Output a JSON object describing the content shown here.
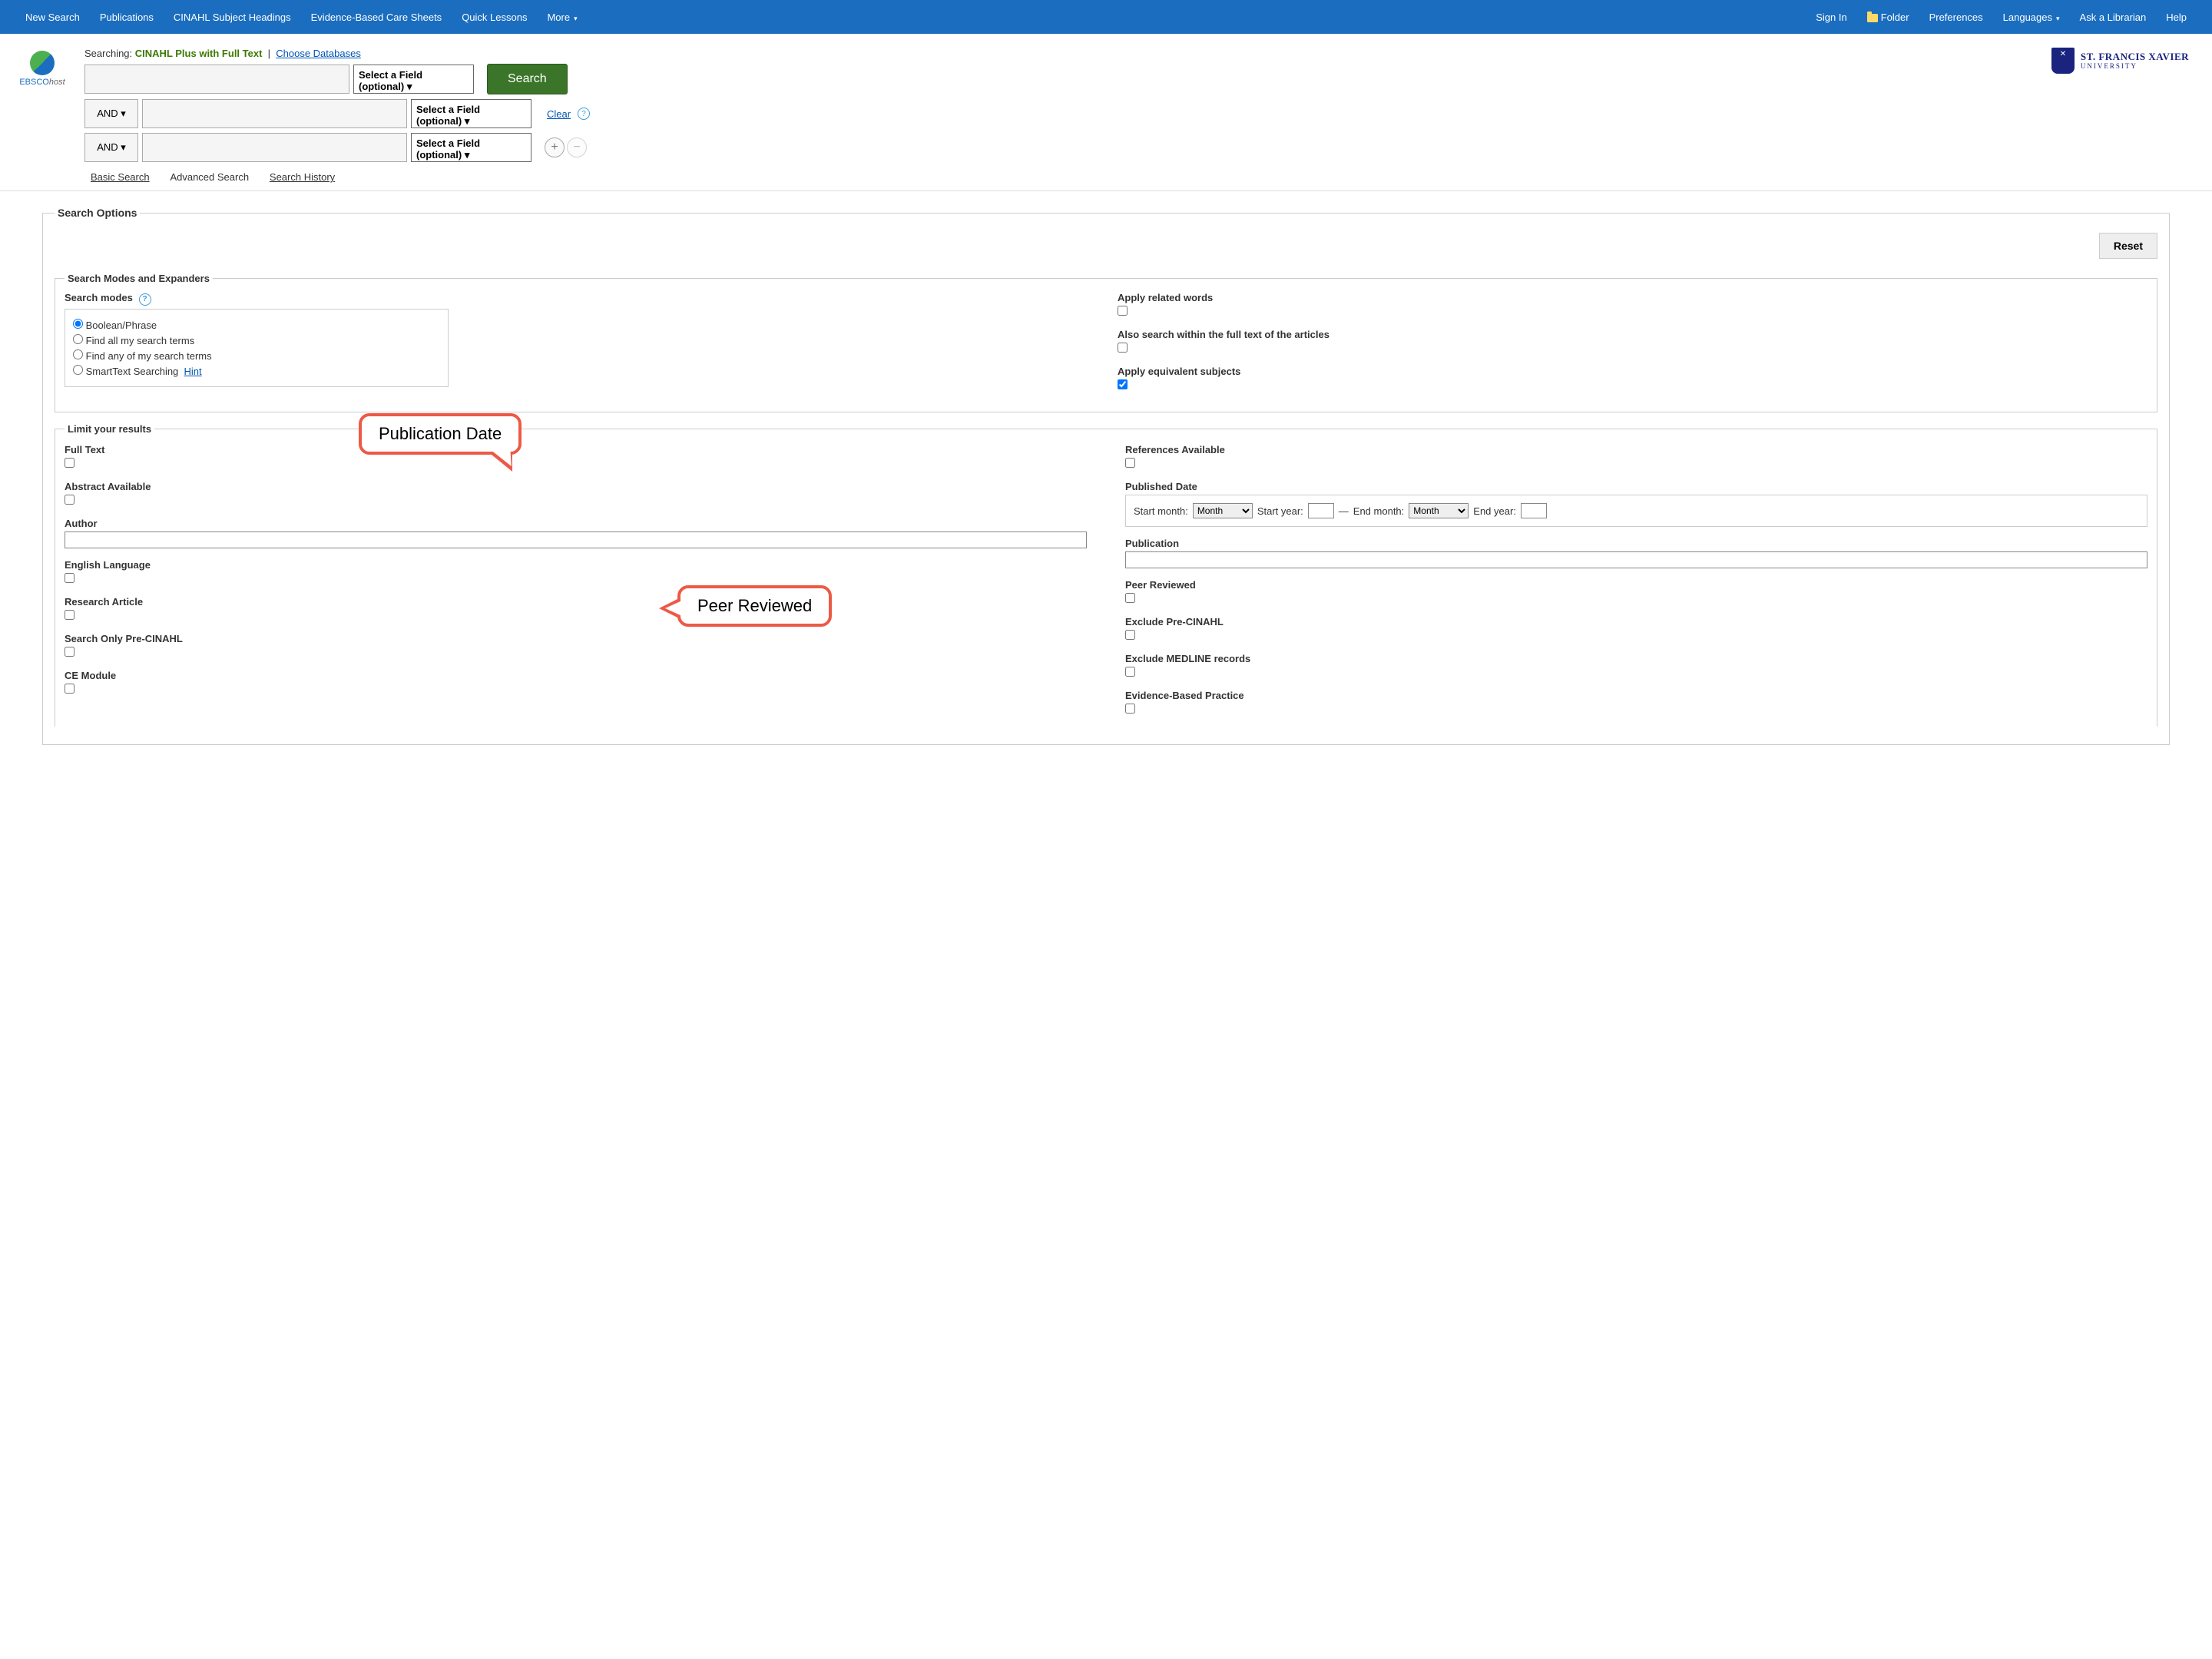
{
  "topbar": {
    "left": [
      "New Search",
      "Publications",
      "CINAHL Subject Headings",
      "Evidence-Based Care Sheets",
      "Quick Lessons",
      "More"
    ],
    "right": [
      "Sign In",
      "Folder",
      "Preferences",
      "Languages",
      "Ask a Librarian",
      "Help"
    ]
  },
  "logo": {
    "text1": "EBSCO",
    "text2": "host"
  },
  "university": {
    "line1": "ST. FRANCIS XAVIER",
    "line2": "UNIVERSITY"
  },
  "searching": {
    "label": "Searching:",
    "db": "CINAHL Plus with Full Text",
    "choose": "Choose Databases"
  },
  "field_select": "Select a Field (optional)",
  "bool": "AND",
  "search_btn": "Search",
  "clear": "Clear",
  "modes": {
    "basic": "Basic Search",
    "advanced": "Advanced Search",
    "history": "Search History"
  },
  "options": {
    "legend": "Search Options",
    "reset": "Reset",
    "modes_legend": "Search Modes and Expanders",
    "search_modes_label": "Search modes",
    "radios": [
      "Boolean/Phrase",
      "Find all my search terms",
      "Find any of my search terms",
      "SmartText Searching"
    ],
    "hint": "Hint",
    "expanders": {
      "related": "Apply related words",
      "fulltext": "Also search within the full text of the articles",
      "equiv": "Apply equivalent subjects"
    },
    "limit_legend": "Limit your results",
    "left_limits": [
      "Full Text",
      "Abstract Available",
      "Author",
      "English Language",
      "Research Article",
      "Search Only Pre-CINAHL",
      "CE Module"
    ],
    "right_limits": {
      "refs": "References Available",
      "pubdate": "Published Date",
      "start_month": "Start month:",
      "month": "Month",
      "start_year": "Start year:",
      "dash": "—",
      "end_month": "End month:",
      "end_year": "End year:",
      "publication": "Publication",
      "peer": "Peer Reviewed",
      "exclude_pre": "Exclude Pre-CINAHL",
      "exclude_med": "Exclude MEDLINE records",
      "ebp": "Evidence-Based Practice"
    }
  },
  "callouts": {
    "c1": "Publication Date",
    "c2": "Peer Reviewed"
  }
}
